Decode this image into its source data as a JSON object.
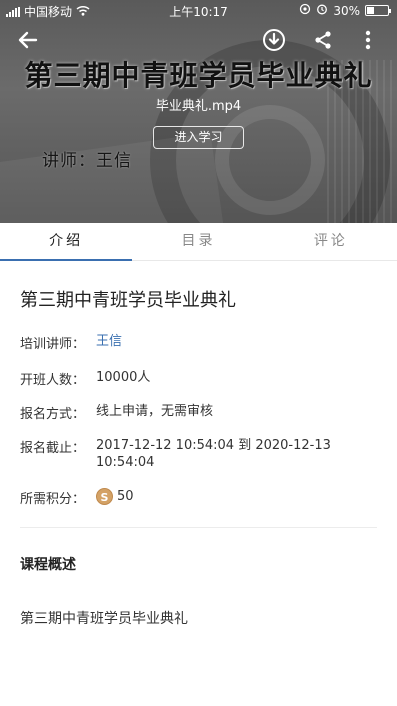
{
  "status_bar": {
    "carrier": "中国移动",
    "time": "上午10:17",
    "battery": "30%"
  },
  "hero": {
    "title": "第三期中青班学员毕业典礼",
    "file_name": "毕业典礼.mp4",
    "enter_button": "进入学习",
    "teacher_text": "讲师：王信"
  },
  "tabs": [
    {
      "label": "介绍",
      "active": true
    },
    {
      "label": "目录",
      "active": false
    },
    {
      "label": "评论",
      "active": false
    }
  ],
  "course": {
    "title": "第三期中青班学员毕业典礼",
    "fields": [
      {
        "label": "培训讲师：",
        "value": "王信"
      },
      {
        "label": "开班人数：",
        "value": "10000人"
      },
      {
        "label": "报名方式：",
        "value": "线上申请，无需审核"
      },
      {
        "label": "报名截止：",
        "value": "2017-12-12 10:54:04 到 2020-12-13 10:54:04"
      },
      {
        "label": "所需积分：",
        "value": "50"
      }
    ],
    "overview_heading": "课程概述",
    "overview_text": "第三期中青班学员毕业典礼"
  },
  "icons": {
    "back": "arrow-left-icon",
    "download": "download-icon",
    "share": "share-icon",
    "more": "more-vertical-icon",
    "points": "coin-icon"
  },
  "colors": {
    "accent": "#3a6fb0",
    "coin": "#d4a266"
  }
}
